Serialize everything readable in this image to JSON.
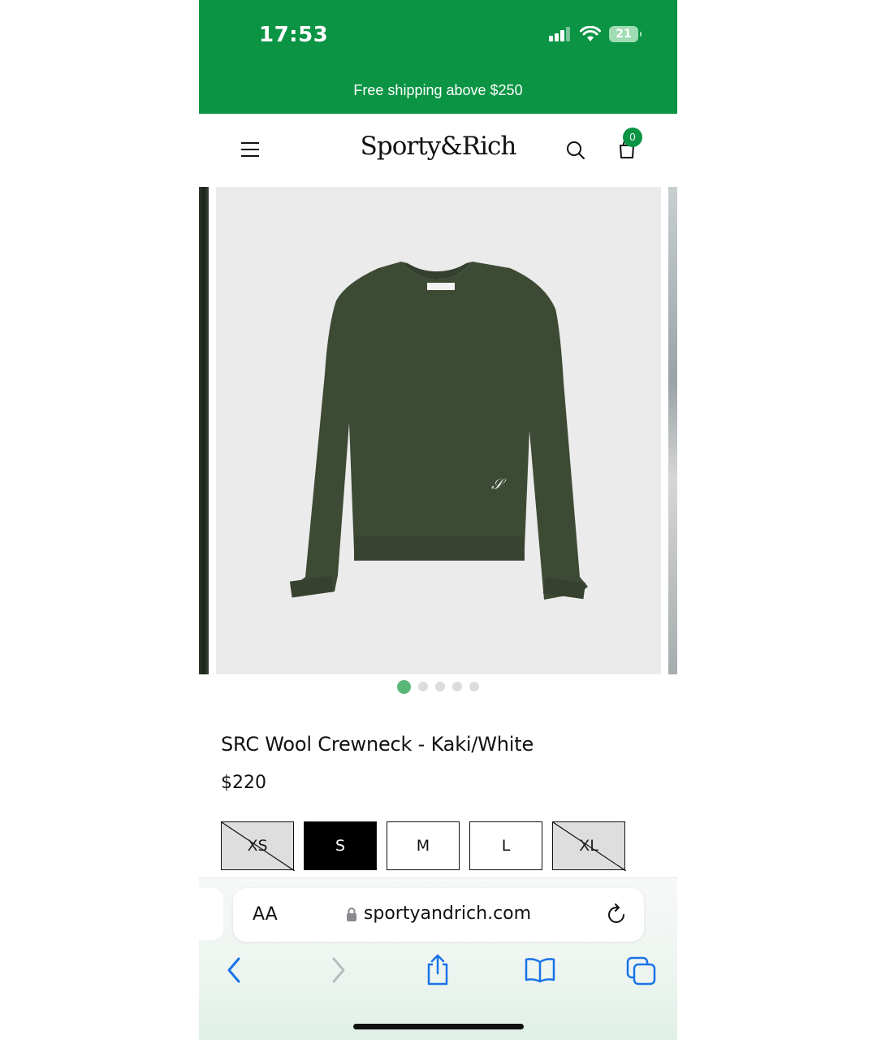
{
  "status_bar": {
    "time": "17:53",
    "battery": "21"
  },
  "promo_banner": {
    "text": "Free shipping above $250"
  },
  "header": {
    "logo": "Sporty&Rich",
    "cart_count": "0"
  },
  "product": {
    "title": "SRC Wool Crewneck - Kaki/White",
    "price": "$220",
    "image_count": 5,
    "active_image": 1,
    "sizes": [
      {
        "label": "XS",
        "state": "unavailable"
      },
      {
        "label": "S",
        "state": "selected"
      },
      {
        "label": "M",
        "state": "available"
      },
      {
        "label": "L",
        "state": "available"
      },
      {
        "label": "XL",
        "state": "unavailable"
      }
    ]
  },
  "browser": {
    "text_size_label": "AA",
    "url": "sportyandrich.com"
  },
  "colors": {
    "brand_green": "#0a9444",
    "active_dot": "#5bb679",
    "ios_blue": "#1a73e8"
  },
  "icons": [
    "menu-icon",
    "search-icon",
    "cart-icon",
    "lock-icon",
    "reload-icon",
    "back-icon",
    "forward-icon",
    "share-icon",
    "bookmarks-icon",
    "tabs-icon"
  ]
}
